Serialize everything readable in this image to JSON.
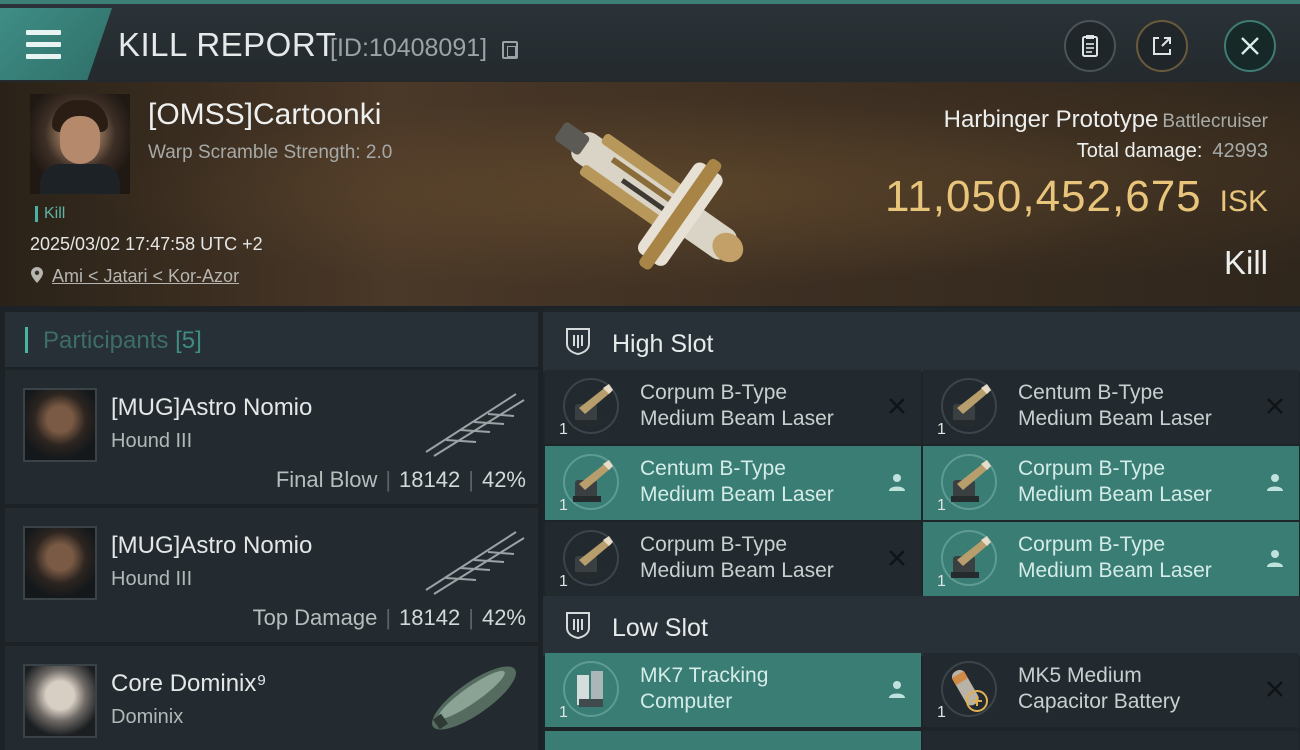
{
  "header": {
    "title": "KILL REPORT",
    "report_id": "[ID:10408091]"
  },
  "victim": {
    "name": "[OMSS]Cartoonki",
    "warp_scramble": "Warp Scramble Strength: 2.0",
    "result_tag": "Kill",
    "time": "2025/03/02 17:47:58 UTC +2",
    "location": "Ami < Jatari < Kor-Azor",
    "ship_name": "Harbinger Prototype",
    "ship_class": "Battlecruiser",
    "total_damage_label": "Total damage:",
    "total_damage": "42993",
    "isk_value": "11,050,452,675",
    "isk_unit": "ISK",
    "result": "Kill"
  },
  "participants": {
    "label": "Participants",
    "count": "[5]",
    "items": [
      {
        "name": "[MUG]Astro Nomio",
        "ship": "Hound III",
        "role": "Final Blow",
        "damage": "18142",
        "percent": "42%"
      },
      {
        "name": "[MUG]Astro Nomio",
        "ship": "Hound III",
        "role": "Top Damage",
        "damage": "18142",
        "percent": "42%"
      },
      {
        "name": "Core Dominix⁹",
        "ship": "Dominix",
        "role": "",
        "damage": "",
        "percent": ""
      }
    ]
  },
  "fitting": {
    "high_slot_label": "High Slot",
    "low_slot_label": "Low Slot",
    "high_slot": [
      {
        "qty": "1",
        "name_1": "Corpum B-Type",
        "name_2": "Medium Beam Laser",
        "status": "destroyed"
      },
      {
        "qty": "1",
        "name_1": "Centum B-Type",
        "name_2": "Medium Beam Laser",
        "status": "destroyed"
      },
      {
        "qty": "1",
        "name_1": "Centum B-Type",
        "name_2": "Medium Beam Laser",
        "status": "dropped"
      },
      {
        "qty": "1",
        "name_1": "Corpum B-Type",
        "name_2": "Medium Beam Laser",
        "status": "dropped"
      },
      {
        "qty": "1",
        "name_1": "Corpum B-Type",
        "name_2": "Medium Beam Laser",
        "status": "destroyed"
      },
      {
        "qty": "1",
        "name_1": "Corpum B-Type",
        "name_2": "Medium Beam Laser",
        "status": "dropped"
      }
    ],
    "low_slot": [
      {
        "qty": "1",
        "name_1": "MK7 Tracking",
        "name_2": "Computer",
        "status": "dropped"
      },
      {
        "qty": "1",
        "name_1": "MK5 Medium",
        "name_2": "Capacitor Battery",
        "status": "destroyed"
      }
    ]
  },
  "colors": {
    "accent": "#3f8e86",
    "isk": "#e8c57a",
    "dropped_bg": "#3a7d74"
  },
  "icons": {
    "menu": "hamburger-icon",
    "copy": "copy-icon",
    "clipboard": "clipboard-icon",
    "share": "share-icon",
    "close": "close-icon",
    "location": "map-pin-icon",
    "slot": "slot-icon",
    "destroyed": "x-icon",
    "dropped": "person-icon"
  }
}
